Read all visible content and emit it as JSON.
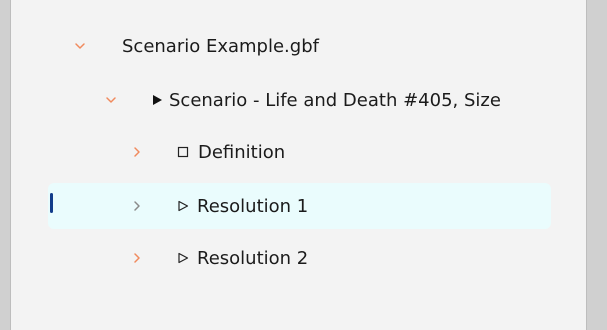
{
  "colors": {
    "chevron_expanded": "#f08a5d",
    "chevron_collapsed_accent": "#f08a5d",
    "chevron_collapsed_muted": "#8a8a8a",
    "selected_row_bg": "#eafcfd",
    "selection_indicator": "#123c8a"
  },
  "tree": {
    "root": {
      "label": "Scenario Example.gbf",
      "expanded": true,
      "icon": "chevron-down-icon"
    },
    "scenario": {
      "label": "Scenario - Life and Death #405, Size",
      "expanded": true,
      "node_icon": "play-filled-icon"
    },
    "definition": {
      "label": "Definition",
      "expanded": false,
      "node_icon": "square-outline-icon"
    },
    "resolution1": {
      "label": "Resolution 1",
      "expanded": false,
      "selected": true,
      "node_icon": "play-outline-icon"
    },
    "resolution2": {
      "label": "Resolution 2",
      "expanded": false,
      "node_icon": "play-outline-icon"
    }
  }
}
